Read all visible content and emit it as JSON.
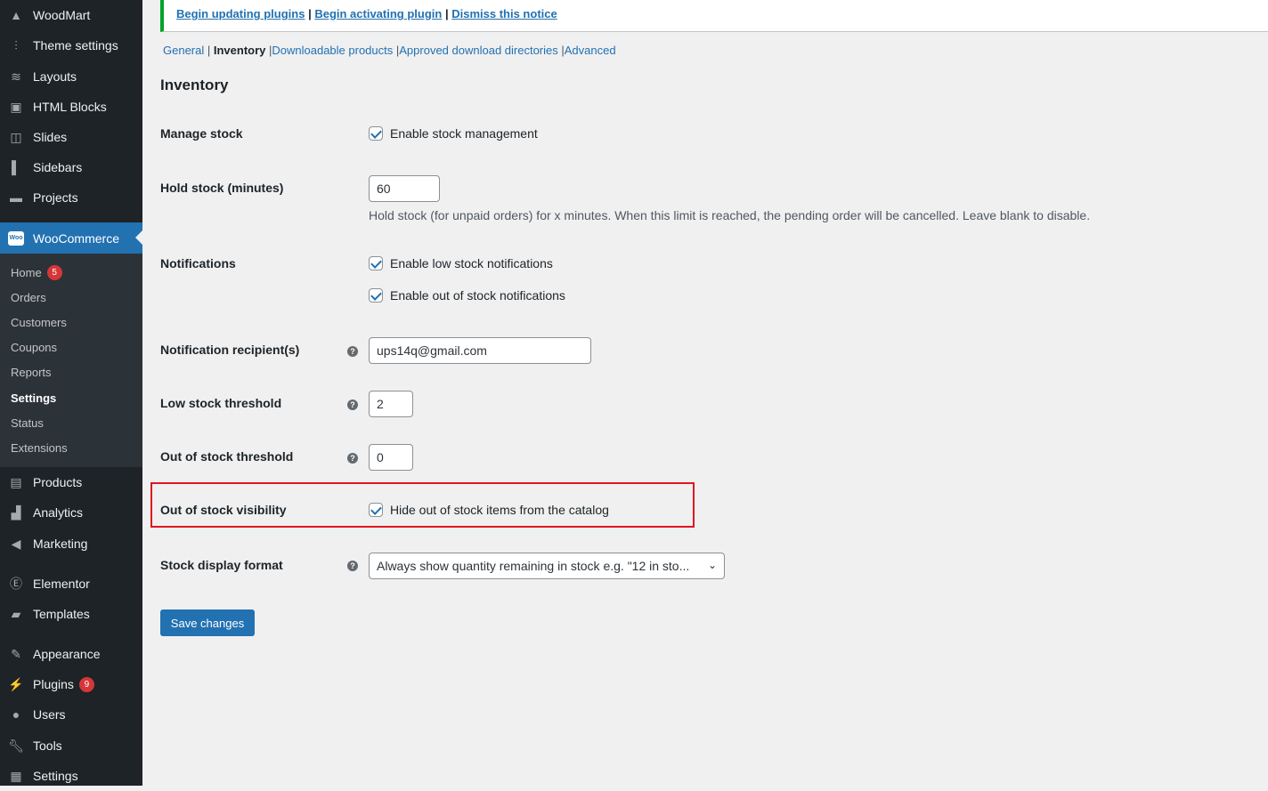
{
  "sidebar": {
    "top": [
      {
        "label": "WoodMart",
        "icon": "woodmart-icon"
      },
      {
        "label": "Theme settings",
        "icon": "sliders-icon"
      },
      {
        "label": "Layouts",
        "icon": "layers-icon"
      },
      {
        "label": "HTML Blocks",
        "icon": "code-block-icon"
      },
      {
        "label": "Slides",
        "icon": "slides-icon"
      },
      {
        "label": "Sidebars",
        "icon": "sidebar-icon"
      },
      {
        "label": "Projects",
        "icon": "briefcase-icon"
      }
    ],
    "woocommerce": "WooCommerce",
    "woo_icon_text": "Woo",
    "sub": [
      {
        "label": "Home",
        "badge": "5"
      },
      {
        "label": "Orders"
      },
      {
        "label": "Customers"
      },
      {
        "label": "Coupons"
      },
      {
        "label": "Reports"
      },
      {
        "label": "Settings",
        "current": true
      },
      {
        "label": "Status"
      },
      {
        "label": "Extensions"
      }
    ],
    "bottom": [
      {
        "label": "Products",
        "icon": "archive-icon"
      },
      {
        "label": "Analytics",
        "icon": "bar-chart-icon"
      },
      {
        "label": "Marketing",
        "icon": "megaphone-icon"
      },
      {
        "label": "Elementor",
        "icon": "elementor-icon"
      },
      {
        "label": "Templates",
        "icon": "folder-icon"
      },
      {
        "label": "Appearance",
        "icon": "brush-icon"
      },
      {
        "label": "Plugins",
        "icon": "plug-icon",
        "badge": "9"
      },
      {
        "label": "Users",
        "icon": "user-icon"
      },
      {
        "label": "Tools",
        "icon": "wrench-icon"
      },
      {
        "label": "Settings",
        "icon": "settings-icon"
      }
    ]
  },
  "notice": {
    "links": [
      "Begin updating plugins",
      "Begin activating plugin",
      "Dismiss this notice"
    ],
    "sep": "|"
  },
  "tabs": [
    {
      "label": "General"
    },
    {
      "label": "Inventory",
      "current": true
    },
    {
      "label": "Downloadable products"
    },
    {
      "label": "Approved download directories"
    },
    {
      "label": "Advanced"
    }
  ],
  "heading": "Inventory",
  "form": {
    "manage_stock": {
      "label": "Manage stock",
      "checkbox": "Enable stock management",
      "checked": true
    },
    "hold_stock": {
      "label": "Hold stock (minutes)",
      "value": "60",
      "desc": "Hold stock (for unpaid orders) for x minutes. When this limit is reached, the pending order will be cancelled. Leave blank to disable."
    },
    "notifications": {
      "label": "Notifications",
      "low": "Enable low stock notifications",
      "out": "Enable out of stock notifications"
    },
    "recipient": {
      "label": "Notification recipient(s)",
      "value": "ups14q@gmail.com"
    },
    "low_threshold": {
      "label": "Low stock threshold",
      "value": "2"
    },
    "out_threshold": {
      "label": "Out of stock threshold",
      "value": "0"
    },
    "visibility": {
      "label": "Out of stock visibility",
      "checkbox": "Hide out of stock items from the catalog",
      "checked": true
    },
    "display_format": {
      "label": "Stock display format",
      "value": "Always show quantity remaining in stock e.g. \"12 in sto..."
    },
    "help": "?"
  },
  "save": "Save changes",
  "colors": {
    "accent": "#2271b1",
    "highlight": "#e0161e",
    "sidebar": "#1d2327"
  }
}
